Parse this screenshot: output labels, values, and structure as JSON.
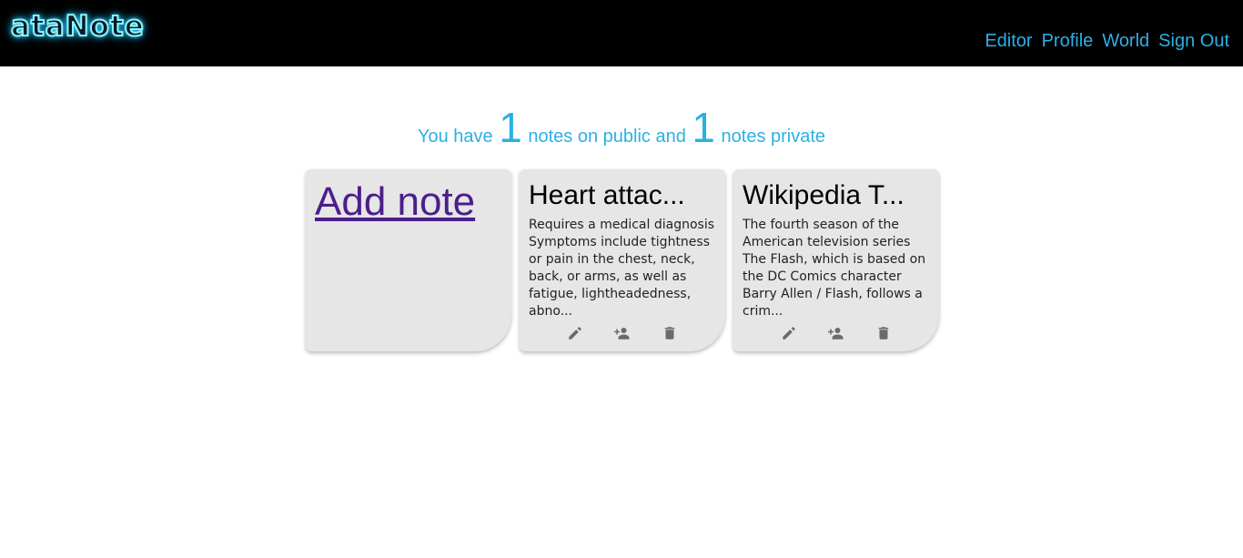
{
  "header": {
    "logo": "ataNote",
    "nav": [
      {
        "label": "Editor"
      },
      {
        "label": "Profile"
      },
      {
        "label": "World"
      },
      {
        "label": "Sign Out"
      }
    ]
  },
  "summary": {
    "prefix": "You have",
    "public_count": "1",
    "public_text": "notes on public and",
    "private_count": "1",
    "private_text": "notes private"
  },
  "add_note": {
    "label": "Add note"
  },
  "notes": [
    {
      "title": "Heart attac...",
      "body": "Requires a medical diagnosis Symptoms include tightness or pain in the chest, neck, back, or arms, as well as fatigue, lightheadedness, abno...",
      "actions": [
        "pen-icon",
        "share-user-icon",
        "trash-icon"
      ]
    },
    {
      "title": "Wikipedia T...",
      "body": "The fourth season of the American television series The Flash, which is based on the DC Comics character Barry Allen / Flash, follows a crim...",
      "actions": [
        "pen-icon",
        "share-user-icon",
        "trash-icon"
      ]
    }
  ],
  "colors": {
    "accent": "#2bb0e6",
    "header_bg": "#000000",
    "card_bg": "#e6e6e6",
    "link_visited": "#4b1e8c"
  }
}
